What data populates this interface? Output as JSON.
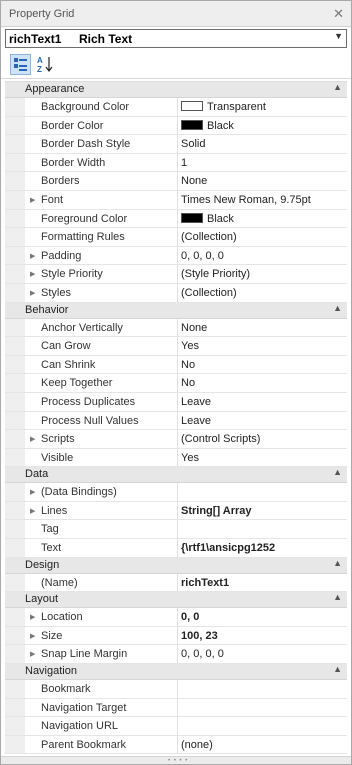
{
  "window": {
    "title": "Property Grid",
    "close_glyph": "✕"
  },
  "selector": {
    "name": "richText1",
    "type": "Rich Text"
  },
  "toolbar": {
    "categorized_icon": "categorized-icon",
    "alphabetical_icon": "alphabetical-sort-icon"
  },
  "colors": {
    "category_bg": "#e7e7e7",
    "selected_button": "#cde3f7",
    "swatch_black": "#000000",
    "swatch_white": "#ffffff"
  },
  "categories": [
    {
      "name": "Appearance",
      "rows": [
        {
          "name": "Background Color",
          "value": "Transparent",
          "swatch": "white"
        },
        {
          "name": "Border Color",
          "value": "Black",
          "swatch": "black"
        },
        {
          "name": "Border Dash Style",
          "value": "Solid"
        },
        {
          "name": "Border Width",
          "value": "1"
        },
        {
          "name": "Borders",
          "value": "None"
        },
        {
          "name": "Font",
          "value": "Times New Roman, 9.75pt",
          "expandable": true
        },
        {
          "name": "Foreground Color",
          "value": "Black",
          "swatch": "black"
        },
        {
          "name": "Formatting Rules",
          "value": "(Collection)"
        },
        {
          "name": "Padding",
          "value": "0, 0, 0, 0",
          "expandable": true
        },
        {
          "name": "Style Priority",
          "value": "(Style Priority)",
          "expandable": true
        },
        {
          "name": "Styles",
          "value": "(Collection)",
          "expandable": true
        }
      ]
    },
    {
      "name": "Behavior",
      "rows": [
        {
          "name": "Anchor Vertically",
          "value": "None"
        },
        {
          "name": "Can Grow",
          "value": "Yes"
        },
        {
          "name": "Can Shrink",
          "value": "No"
        },
        {
          "name": "Keep Together",
          "value": "No"
        },
        {
          "name": "Process Duplicates",
          "value": "Leave"
        },
        {
          "name": "Process Null Values",
          "value": "Leave"
        },
        {
          "name": "Scripts",
          "value": "(Control Scripts)",
          "expandable": true
        },
        {
          "name": "Visible",
          "value": "Yes"
        }
      ]
    },
    {
      "name": "Data",
      "rows": [
        {
          "name": "(Data Bindings)",
          "value": "",
          "expandable": true
        },
        {
          "name": "Lines",
          "value": "String[] Array",
          "expandable": true,
          "bold": true
        },
        {
          "name": "Tag",
          "value": ""
        },
        {
          "name": "Text",
          "value": "{\\rtf1\\ansicpg1252",
          "bold": true
        }
      ]
    },
    {
      "name": "Design",
      "rows": [
        {
          "name": "(Name)",
          "value": "richText1",
          "bold": true
        }
      ]
    },
    {
      "name": "Layout",
      "rows": [
        {
          "name": "Location",
          "value": "0, 0",
          "expandable": true,
          "bold": true
        },
        {
          "name": "Size",
          "value": "100, 23",
          "expandable": true,
          "bold": true
        },
        {
          "name": "Snap Line Margin",
          "value": "0, 0, 0, 0",
          "expandable": true
        }
      ]
    },
    {
      "name": "Navigation",
      "rows": [
        {
          "name": "Bookmark",
          "value": ""
        },
        {
          "name": "Navigation Target",
          "value": ""
        },
        {
          "name": "Navigation URL",
          "value": ""
        },
        {
          "name": "Parent Bookmark",
          "value": "(none)"
        }
      ]
    }
  ]
}
